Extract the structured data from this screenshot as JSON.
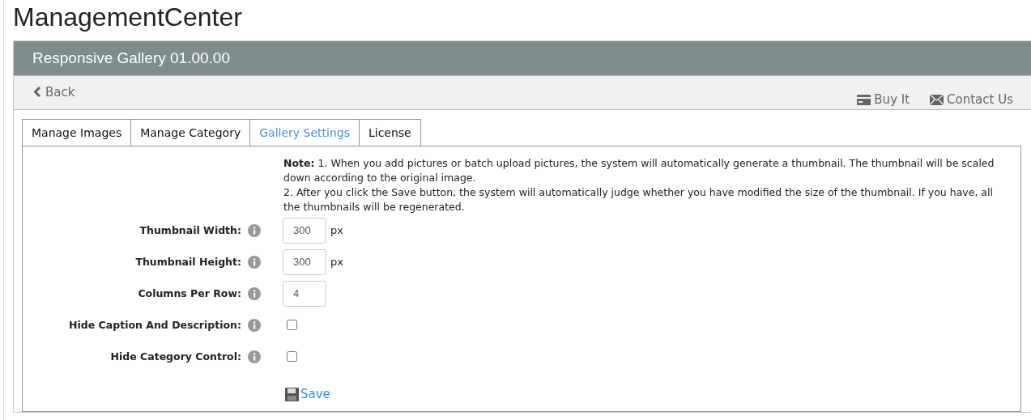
{
  "page_title": "ManagementCenter",
  "panel_title": "Responsive Gallery 01.00.00",
  "toolbar": {
    "back": "Back",
    "actions": [
      {
        "kind": "card",
        "label": "Buy It"
      },
      {
        "kind": "mail",
        "label": "Contact Us"
      }
    ]
  },
  "tabs": [
    {
      "label": "Manage Images",
      "selected": false
    },
    {
      "label": "Manage Category",
      "selected": false
    },
    {
      "label": "Gallery Settings",
      "selected": true
    },
    {
      "label": "License",
      "selected": false
    }
  ],
  "note": [
    "**Note:** 1. When you add pictures or batch upload pictures, the system will automatically generate a thumbnail. The thumbnail will be scaled down according to the original image.",
    "2. After you click the Save button, the system will automatically judge whether you have modified the size of the thumbnail. If you have, all the thumbnails will be regenerated."
  ],
  "fields": [
    {
      "kind": "text",
      "label": "Thumbnail Width:",
      "value": "300",
      "unit": "px"
    },
    {
      "kind": "text",
      "label": "Thumbnail Height:",
      "value": "300",
      "unit": "px"
    },
    {
      "kind": "text",
      "label": "Columns Per Row:",
      "value": "4"
    },
    {
      "kind": "checkbox",
      "label": "Hide Caption And Description:",
      "checked": false
    },
    {
      "kind": "checkbox",
      "label": "Hide Category Control:",
      "checked": false
    }
  ],
  "save": "Save"
}
